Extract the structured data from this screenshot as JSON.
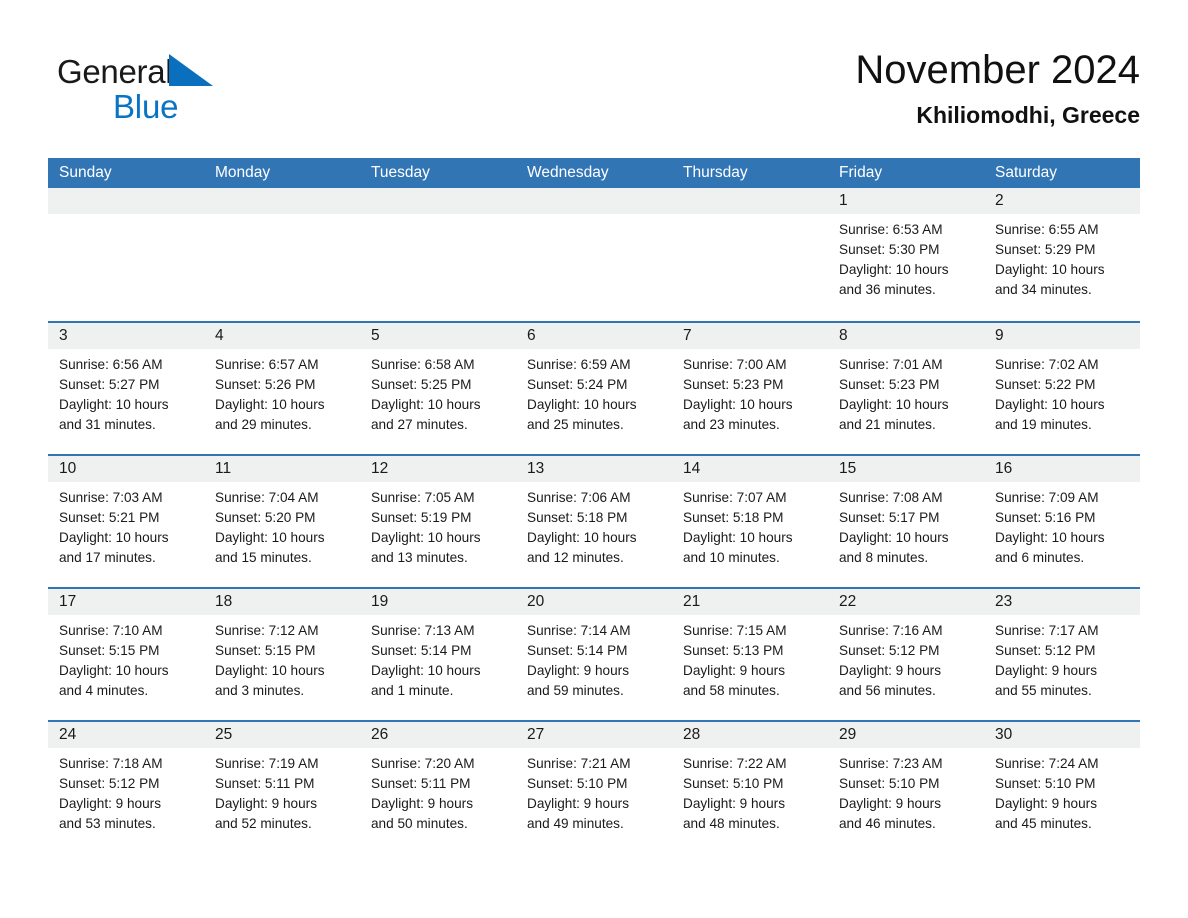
{
  "brand": {
    "name_part1": "General",
    "name_part2": "Blue",
    "triangle_icon": "brand-triangle-icon",
    "accent_color": "#0a74c4"
  },
  "header": {
    "title": "November 2024",
    "subtitle": "Khiliomodhi, Greece"
  },
  "theme": {
    "header_blue": "#3275b5",
    "date_band_gray": "#eff0f0",
    "text_color": "#1a1a1a"
  },
  "weekdays": [
    "Sunday",
    "Monday",
    "Tuesday",
    "Wednesday",
    "Thursday",
    "Friday",
    "Saturday"
  ],
  "weeks": [
    [
      {
        "day": "",
        "lines": []
      },
      {
        "day": "",
        "lines": []
      },
      {
        "day": "",
        "lines": []
      },
      {
        "day": "",
        "lines": []
      },
      {
        "day": "",
        "lines": []
      },
      {
        "day": "1",
        "lines": [
          "Sunrise: 6:53 AM",
          "Sunset: 5:30 PM",
          "Daylight: 10 hours",
          "and 36 minutes."
        ]
      },
      {
        "day": "2",
        "lines": [
          "Sunrise: 6:55 AM",
          "Sunset: 5:29 PM",
          "Daylight: 10 hours",
          "and 34 minutes."
        ]
      }
    ],
    [
      {
        "day": "3",
        "lines": [
          "Sunrise: 6:56 AM",
          "Sunset: 5:27 PM",
          "Daylight: 10 hours",
          "and 31 minutes."
        ]
      },
      {
        "day": "4",
        "lines": [
          "Sunrise: 6:57 AM",
          "Sunset: 5:26 PM",
          "Daylight: 10 hours",
          "and 29 minutes."
        ]
      },
      {
        "day": "5",
        "lines": [
          "Sunrise: 6:58 AM",
          "Sunset: 5:25 PM",
          "Daylight: 10 hours",
          "and 27 minutes."
        ]
      },
      {
        "day": "6",
        "lines": [
          "Sunrise: 6:59 AM",
          "Sunset: 5:24 PM",
          "Daylight: 10 hours",
          "and 25 minutes."
        ]
      },
      {
        "day": "7",
        "lines": [
          "Sunrise: 7:00 AM",
          "Sunset: 5:23 PM",
          "Daylight: 10 hours",
          "and 23 minutes."
        ]
      },
      {
        "day": "8",
        "lines": [
          "Sunrise: 7:01 AM",
          "Sunset: 5:23 PM",
          "Daylight: 10 hours",
          "and 21 minutes."
        ]
      },
      {
        "day": "9",
        "lines": [
          "Sunrise: 7:02 AM",
          "Sunset: 5:22 PM",
          "Daylight: 10 hours",
          "and 19 minutes."
        ]
      }
    ],
    [
      {
        "day": "10",
        "lines": [
          "Sunrise: 7:03 AM",
          "Sunset: 5:21 PM",
          "Daylight: 10 hours",
          "and 17 minutes."
        ]
      },
      {
        "day": "11",
        "lines": [
          "Sunrise: 7:04 AM",
          "Sunset: 5:20 PM",
          "Daylight: 10 hours",
          "and 15 minutes."
        ]
      },
      {
        "day": "12",
        "lines": [
          "Sunrise: 7:05 AM",
          "Sunset: 5:19 PM",
          "Daylight: 10 hours",
          "and 13 minutes."
        ]
      },
      {
        "day": "13",
        "lines": [
          "Sunrise: 7:06 AM",
          "Sunset: 5:18 PM",
          "Daylight: 10 hours",
          "and 12 minutes."
        ]
      },
      {
        "day": "14",
        "lines": [
          "Sunrise: 7:07 AM",
          "Sunset: 5:18 PM",
          "Daylight: 10 hours",
          "and 10 minutes."
        ]
      },
      {
        "day": "15",
        "lines": [
          "Sunrise: 7:08 AM",
          "Sunset: 5:17 PM",
          "Daylight: 10 hours",
          "and 8 minutes."
        ]
      },
      {
        "day": "16",
        "lines": [
          "Sunrise: 7:09 AM",
          "Sunset: 5:16 PM",
          "Daylight: 10 hours",
          "and 6 minutes."
        ]
      }
    ],
    [
      {
        "day": "17",
        "lines": [
          "Sunrise: 7:10 AM",
          "Sunset: 5:15 PM",
          "Daylight: 10 hours",
          "and 4 minutes."
        ]
      },
      {
        "day": "18",
        "lines": [
          "Sunrise: 7:12 AM",
          "Sunset: 5:15 PM",
          "Daylight: 10 hours",
          "and 3 minutes."
        ]
      },
      {
        "day": "19",
        "lines": [
          "Sunrise: 7:13 AM",
          "Sunset: 5:14 PM",
          "Daylight: 10 hours",
          "and 1 minute."
        ]
      },
      {
        "day": "20",
        "lines": [
          "Sunrise: 7:14 AM",
          "Sunset: 5:14 PM",
          "Daylight: 9 hours",
          "and 59 minutes."
        ]
      },
      {
        "day": "21",
        "lines": [
          "Sunrise: 7:15 AM",
          "Sunset: 5:13 PM",
          "Daylight: 9 hours",
          "and 58 minutes."
        ]
      },
      {
        "day": "22",
        "lines": [
          "Sunrise: 7:16 AM",
          "Sunset: 5:12 PM",
          "Daylight: 9 hours",
          "and 56 minutes."
        ]
      },
      {
        "day": "23",
        "lines": [
          "Sunrise: 7:17 AM",
          "Sunset: 5:12 PM",
          "Daylight: 9 hours",
          "and 55 minutes."
        ]
      }
    ],
    [
      {
        "day": "24",
        "lines": [
          "Sunrise: 7:18 AM",
          "Sunset: 5:12 PM",
          "Daylight: 9 hours",
          "and 53 minutes."
        ]
      },
      {
        "day": "25",
        "lines": [
          "Sunrise: 7:19 AM",
          "Sunset: 5:11 PM",
          "Daylight: 9 hours",
          "and 52 minutes."
        ]
      },
      {
        "day": "26",
        "lines": [
          "Sunrise: 7:20 AM",
          "Sunset: 5:11 PM",
          "Daylight: 9 hours",
          "and 50 minutes."
        ]
      },
      {
        "day": "27",
        "lines": [
          "Sunrise: 7:21 AM",
          "Sunset: 5:10 PM",
          "Daylight: 9 hours",
          "and 49 minutes."
        ]
      },
      {
        "day": "28",
        "lines": [
          "Sunrise: 7:22 AM",
          "Sunset: 5:10 PM",
          "Daylight: 9 hours",
          "and 48 minutes."
        ]
      },
      {
        "day": "29",
        "lines": [
          "Sunrise: 7:23 AM",
          "Sunset: 5:10 PM",
          "Daylight: 9 hours",
          "and 46 minutes."
        ]
      },
      {
        "day": "30",
        "lines": [
          "Sunrise: 7:24 AM",
          "Sunset: 5:10 PM",
          "Daylight: 9 hours",
          "and 45 minutes."
        ]
      }
    ]
  ]
}
